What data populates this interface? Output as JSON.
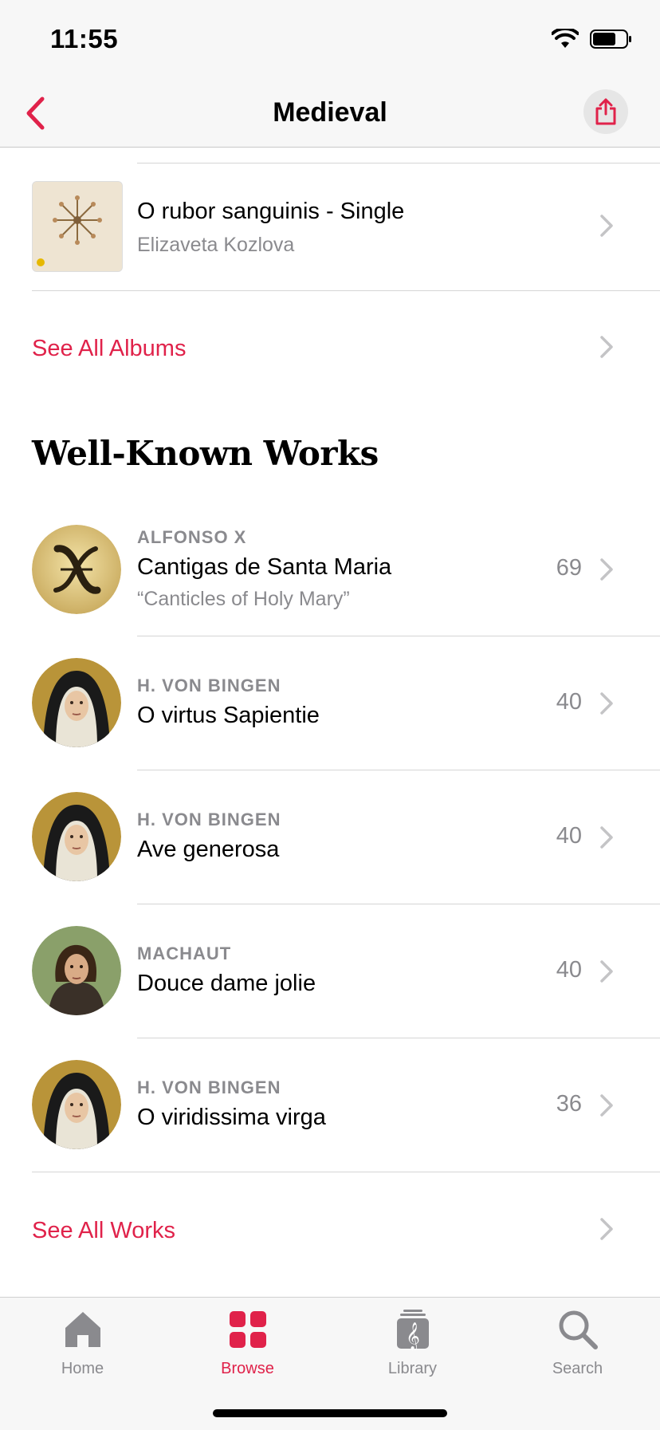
{
  "status": {
    "time": "11:55"
  },
  "nav": {
    "title": "Medieval"
  },
  "album": {
    "title": "O rubor sanguinis - Single",
    "artist": "Elizaveta Kozlova"
  },
  "albums_link": {
    "label": "See All Albums"
  },
  "section": {
    "title": "Well-Known Works"
  },
  "works": [
    {
      "composer": "ALFONSO X",
      "title": "Cantigas de Santa Maria",
      "subtitle": "“Canticles of Holy Mary”",
      "count": "69"
    },
    {
      "composer": "H. VON BINGEN",
      "title": "O virtus Sapientie",
      "count": "40"
    },
    {
      "composer": "H. VON BINGEN",
      "title": "Ave generosa",
      "count": "40"
    },
    {
      "composer": "MACHAUT",
      "title": "Douce dame jolie",
      "count": "40"
    },
    {
      "composer": "H. VON BINGEN",
      "title": "O viridissima virga",
      "count": "36"
    }
  ],
  "works_link": {
    "label": "See All Works"
  },
  "tabs": [
    {
      "label": "Home",
      "icon": "house-icon"
    },
    {
      "label": "Browse",
      "icon": "grid-icon",
      "active": true
    },
    {
      "label": "Library",
      "icon": "music-library-icon"
    },
    {
      "label": "Search",
      "icon": "magnifier-icon"
    }
  ],
  "colors": {
    "accent": "#e0224a",
    "secondary_text": "#8a8a8e",
    "bar_bg": "#f7f7f7"
  }
}
